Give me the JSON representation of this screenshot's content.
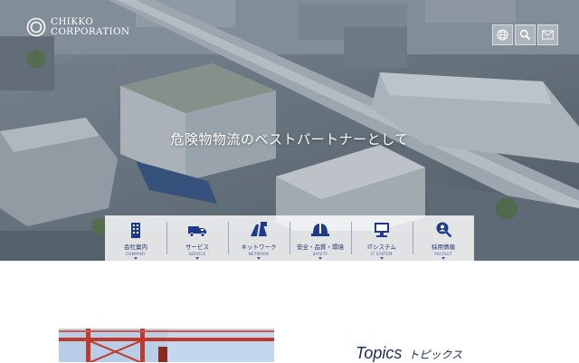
{
  "brand": {
    "line1": "CHIKKO",
    "line2": "CORPORATION",
    "logo_icon": "circle-ring-logo-icon"
  },
  "header_icons": [
    {
      "name": "language-globe-icon"
    },
    {
      "name": "search-icon"
    },
    {
      "name": "mail-icon"
    }
  ],
  "hero": {
    "tagline": "危険物物流のベストパートナーとして"
  },
  "nav": {
    "items": [
      {
        "label": "会社案内",
        "sub": "COMPANY",
        "icon": "building-icon"
      },
      {
        "label": "サービス",
        "sub": "SERVICE",
        "icon": "truck-icon"
      },
      {
        "label": "ネットワーク",
        "sub": "NETWORK",
        "icon": "network-road-icon"
      },
      {
        "label": "安全・品質・環境",
        "sub": "SAFETY",
        "icon": "helmet-icon"
      },
      {
        "label": "ITシステム",
        "sub": "IT SYSTEM",
        "icon": "computer-icon"
      },
      {
        "label": "採用情報",
        "sub": "RECRUIT",
        "icon": "magnifier-person-icon"
      }
    ]
  },
  "topics": {
    "title_en": "Topics",
    "title_ja": "トピックス"
  },
  "colors": {
    "navy": "#1f2f6b",
    "nav_bg": "#ffffff",
    "tagline": "#ffffff"
  }
}
